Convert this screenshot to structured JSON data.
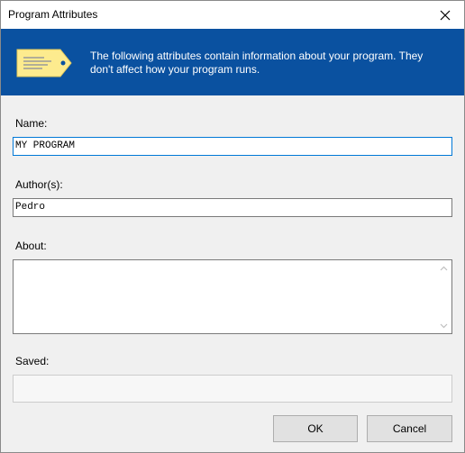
{
  "window": {
    "title": "Program Attributes",
    "close_icon": "close-icon"
  },
  "banner": {
    "icon": "tag-icon",
    "text": "The following attributes contain information about your program. They don't affect how your program runs.",
    "background_color": "#0a51a0"
  },
  "fields": {
    "name": {
      "label": "Name:",
      "value": "MY PROGRAM"
    },
    "authors": {
      "label": "Author(s):",
      "value": "Pedro"
    },
    "about": {
      "label": "About:",
      "value": ""
    },
    "saved": {
      "label": "Saved:",
      "value": ""
    }
  },
  "buttons": {
    "ok": "OK",
    "cancel": "Cancel"
  },
  "colors": {
    "accent": "#0078d7",
    "dialog_background": "#f0f0f0",
    "tag_fill": "#fdeb8e"
  }
}
